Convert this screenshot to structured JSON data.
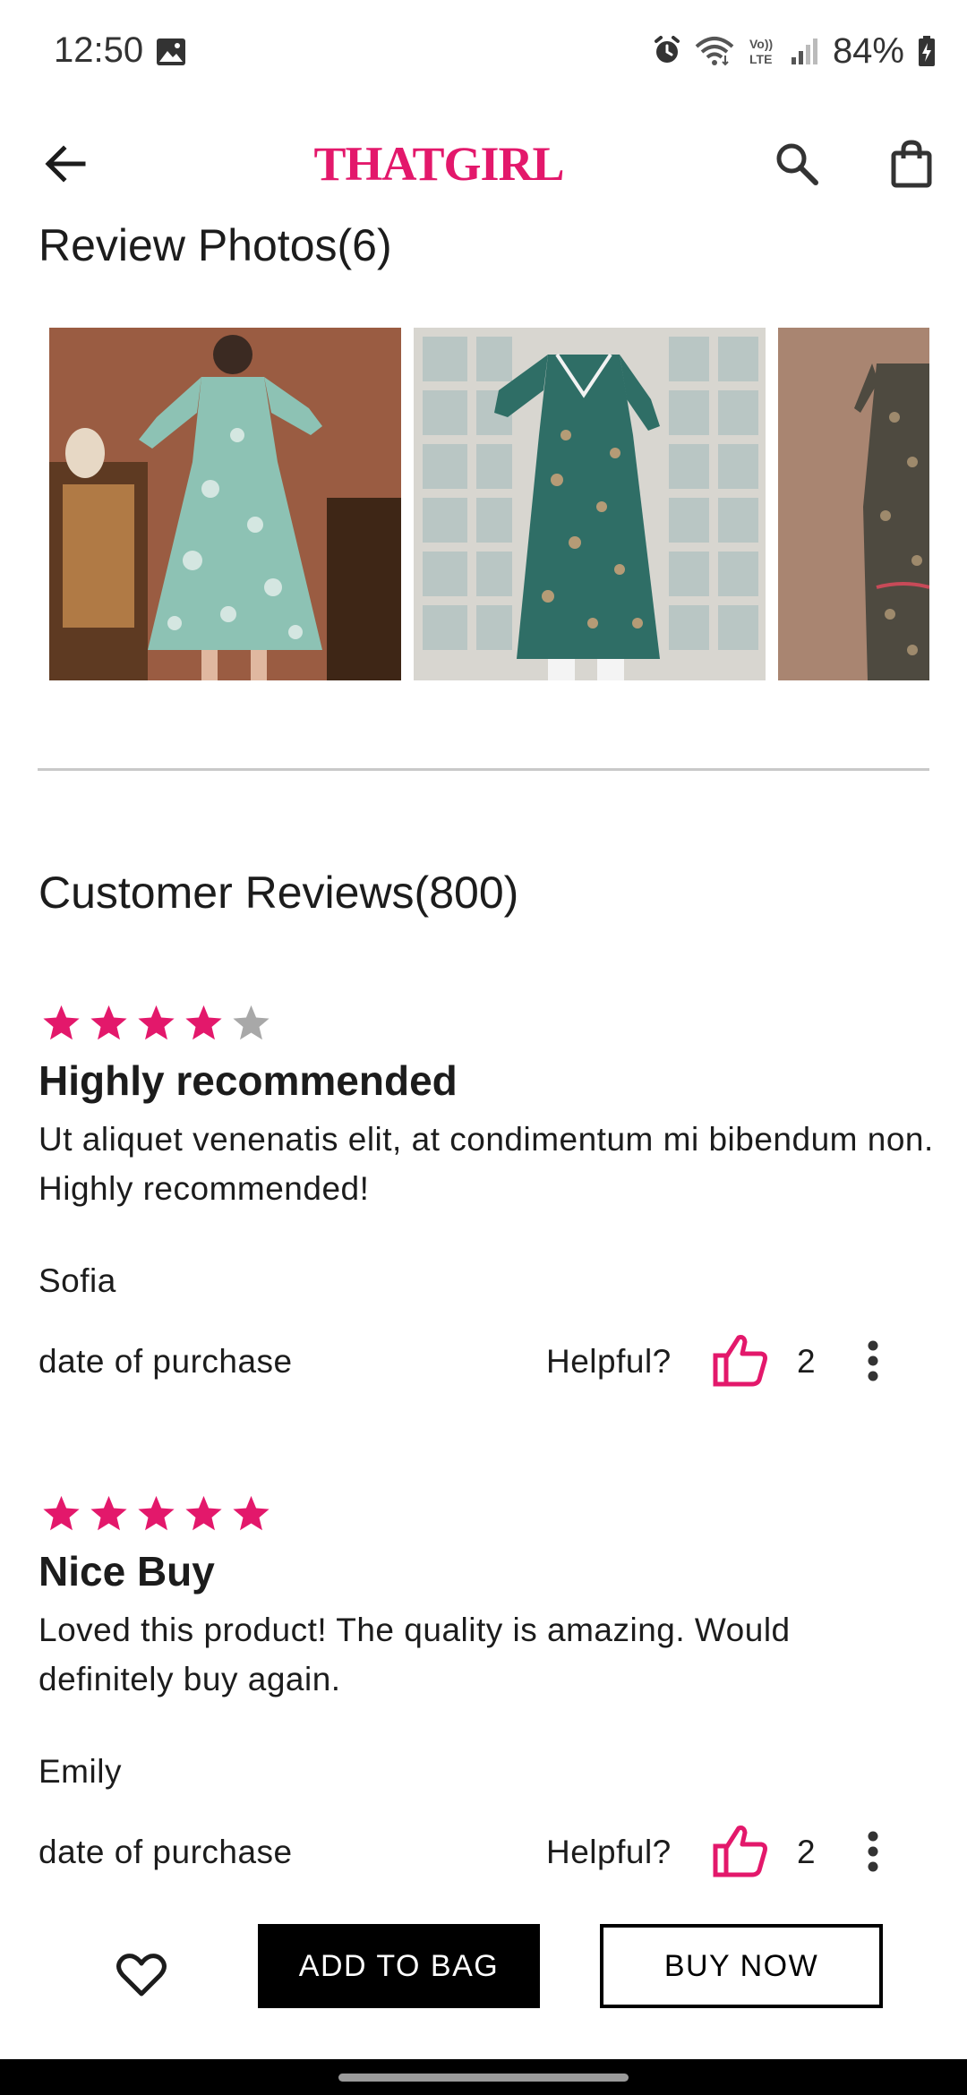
{
  "status_bar": {
    "time": "12:50",
    "battery": "84%",
    "icons": [
      "image-icon",
      "alarm-icon",
      "wifi-icon",
      "volte-icon",
      "signal-icon",
      "battery-charging-icon"
    ]
  },
  "app_bar": {
    "brand": "THATGIRL",
    "brand_color": "#e3186b",
    "icons": [
      "arrow-left-icon",
      "search-icon",
      "shopping-bag-icon"
    ]
  },
  "review_photos": {
    "title": "Review Photos(6)",
    "photos": [
      "photo-1",
      "photo-2",
      "photo-3"
    ]
  },
  "customer_reviews": {
    "title": "Customer Reviews(800)",
    "reviews": [
      {
        "rating": 4,
        "max_rating": 5,
        "title": "Highly recommended",
        "body": "Ut aliquet venenatis elit, at condimentum mi bibendum non. Highly recommended!",
        "author": "Sofia",
        "date_label": "date of purchase",
        "helpful_label": "Helpful?",
        "helpful_count": "2"
      },
      {
        "rating": 5,
        "max_rating": 5,
        "title": "Nice Buy",
        "body": "Loved this product! The quality is amazing. Would definitely buy again.",
        "author": "Emily",
        "date_label": "date of purchase",
        "helpful_label": "Helpful?",
        "helpful_count": "2"
      }
    ]
  },
  "bottom_bar": {
    "add_to_bag": "ADD TO BAG",
    "buy_now": "BUY NOW",
    "icons": [
      "heart-icon"
    ]
  },
  "colors": {
    "accent": "#e3186b",
    "star_filled": "#e3186b",
    "star_empty": "#a8a8a8",
    "text": "#1c1c1c"
  }
}
